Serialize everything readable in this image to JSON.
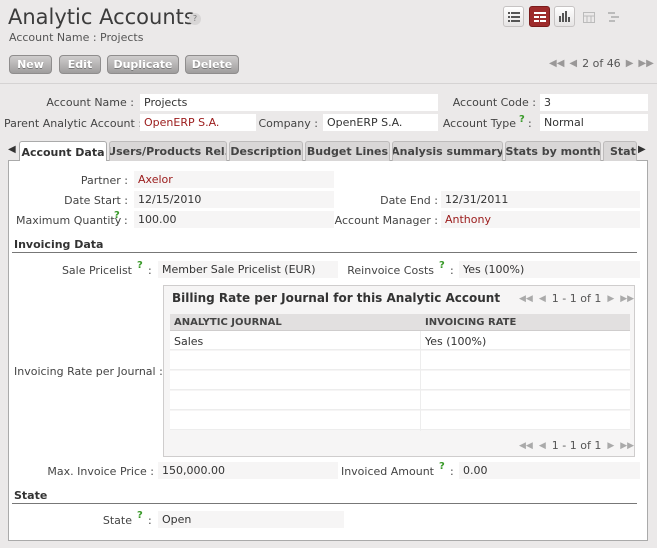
{
  "header": {
    "title": "Analytic Accounts",
    "help": "?",
    "breadcrumb": "Account Name : Projects"
  },
  "views": [
    "list",
    "form",
    "graph",
    "calendar",
    "gantt"
  ],
  "toolbar": {
    "new": "New",
    "edit": "Edit",
    "duplicate": "Duplicate",
    "delete": "Delete"
  },
  "pager": {
    "text": "2 of 46"
  },
  "form": {
    "account_name_label": "Account Name :",
    "account_name": "Projects",
    "account_code_label": "Account Code :",
    "account_code": "3",
    "parent_label": "Parent Analytic Account :",
    "parent": "OpenERP S.A.",
    "company_label": "Company :",
    "company": "OpenERP S.A.",
    "account_type_label": "Account Type",
    "account_type": "Normal",
    "help_mark": "?",
    "colon": ":"
  },
  "tabs": [
    "Account Data",
    "Users/Products Rel.",
    "Description",
    "Budget Lines",
    "Analysis summary",
    "Stats by month",
    "Stats"
  ],
  "account_data": {
    "partner_label": "Partner :",
    "partner": "Axelor",
    "date_start_label": "Date Start :",
    "date_start": "12/15/2010",
    "date_end_label": "Date End :",
    "date_end": "12/31/2011",
    "max_qty_label": "Maximum Quantity",
    "max_qty": "100.00",
    "manager_label": "Account Manager :",
    "manager": "Anthony"
  },
  "invoicing": {
    "section": "Invoicing Data",
    "pricelist_label": "Sale Pricelist",
    "pricelist": "Member Sale Pricelist (EUR)",
    "reinvoice_label": "Reinvoice Costs",
    "reinvoice": "Yes (100%)",
    "rate_label": "Invoicing Rate per Journal :",
    "grid": {
      "title": "Billing Rate per Journal for this Analytic Account",
      "pager": "1 - 1 of 1",
      "columns": [
        "ANALYTIC JOURNAL",
        "INVOICING RATE"
      ],
      "rows": [
        [
          "Sales",
          "Yes (100%)"
        ]
      ]
    },
    "max_price_label": "Max. Invoice Price :",
    "max_price": "150,000.00",
    "invoiced_label": "Invoiced Amount",
    "invoiced": "0.00"
  },
  "state": {
    "section": "State",
    "label": "State",
    "value": "Open"
  }
}
